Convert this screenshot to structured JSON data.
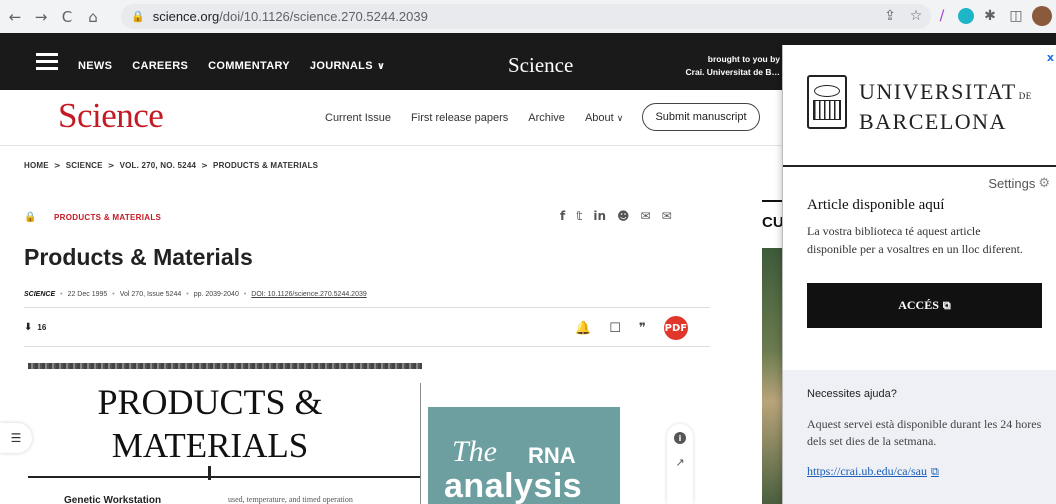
{
  "browser": {
    "back": "←",
    "forward": "→",
    "reload": "C",
    "home": "⌂",
    "lock_icon": "🔒",
    "url_domain": "science.org",
    "url_path": "/doi/10.1126/science.270.5244.2039",
    "share_icon": "⇪",
    "star_icon": "☆",
    "pen_icon": "/",
    "puzzle_icon": "✱",
    "panel_icon": "◫"
  },
  "topbar": {
    "nav": [
      "NEWS",
      "CAREERS",
      "COMMENTARY",
      "JOURNALS"
    ],
    "journals_chevron": "∨",
    "logo": "Science",
    "brought_line1": "brought to you by",
    "brought_line2": "Crai. Universitat de B…"
  },
  "header": {
    "logo": "Science",
    "links": [
      "Current Issue",
      "First release papers",
      "Archive",
      "About"
    ],
    "about_chevron": "∨",
    "submit": "Submit manuscript"
  },
  "breadcrumb": [
    "HOME",
    "SCIENCE",
    "VOL. 270, NO. 5244",
    "PRODUCTS & MATERIALS"
  ],
  "breadcrumb_sep": ">",
  "article": {
    "lock_icon": "🔒",
    "section": "PRODUCTS & MATERIALS",
    "share": [
      "f",
      "𝕥",
      "in",
      "☻",
      "✉",
      "✉"
    ],
    "title": "Products & Materials",
    "journal": "SCIENCE",
    "date": "22 Dec 1995",
    "volume": "Vol 270, Issue 5244",
    "pages": "pp. 2039-2040",
    "doi": "DOI: 10.1126/science.270.5244.2039",
    "meta_sep": "•",
    "download_icon": "⬇",
    "downloads": "16",
    "bell_icon": "🔔",
    "bookmark_icon": "☐",
    "cite_icon": "❞",
    "pdf_icon": "PDF"
  },
  "scan": {
    "heading_line1": "PRODUCTS &",
    "heading_line2": "MATERIALS",
    "subheading": "Genetic Workstation",
    "body_snippet": "used, temperature, and timed operation",
    "ad_the": "The",
    "ad_rna": "RNA",
    "ad_analysis": "analysis"
  },
  "rail": {
    "info_icon": "i",
    "trend_icon": "↗",
    "toc_icon": "☰"
  },
  "sidebar": {
    "label": "CU"
  },
  "popup": {
    "close": "x",
    "univ_line1": "UNIVERSITAT",
    "univ_de": "DE",
    "univ_line2": "BARCELONA",
    "settings": "Settings",
    "gear_icon": "⚙",
    "available_title": "Article disponible aquí",
    "available_text": "La vostra biblioteca té aquest article disponible per a vosaltres en un lloc diferent.",
    "button": "ACCÉS",
    "external_icon": "⧉",
    "help_title": "Necessites ajuda?",
    "help_text": "Aquest servei està disponible durant les 24 hores dels set dies de la setmana.",
    "help_link": "https://crai.ub.edu/ca/sau"
  }
}
